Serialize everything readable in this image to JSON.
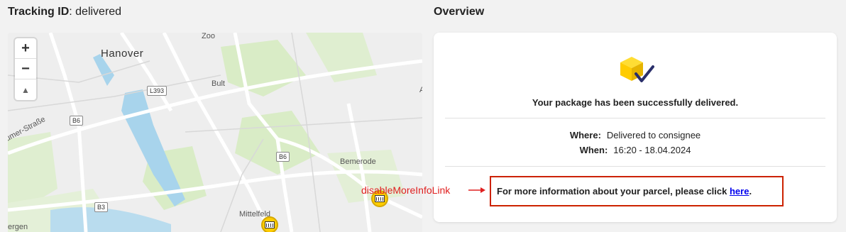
{
  "header": {
    "tracking_label": "Tracking ID",
    "tracking_value": ": delivered",
    "overview_title": "Overview"
  },
  "map": {
    "zoom_in": "+",
    "zoom_out": "−",
    "compass": "▲",
    "labels": {
      "zoo": "Zoo",
      "hanover": "Hanover",
      "bult": "Bult",
      "l393": "L393",
      "b6a": "B6",
      "b6b": "B6",
      "b3": "B3",
      "strasse": "umer-Straße",
      "bemerode": "Bemerode",
      "mittelfeld": "Mittelfeld",
      "bergen": "ergen",
      "a_edge": "A"
    }
  },
  "overview": {
    "status_message": "Your package has been successfully delivered.",
    "where_label": "Where:",
    "where_value": "Delivered to consignee",
    "when_label": "When:",
    "when_value": "16:20 - 18.04.2024",
    "more_info_text": "For more information about your parcel, please click ",
    "more_info_link": "here",
    "more_info_suffix": "."
  },
  "annotation": {
    "label": "disableMoreInfoLink",
    "color": "#e02020"
  },
  "colors": {
    "accent": "#ffcc00",
    "link": "#0000ee",
    "highlight_border": "#cc2200",
    "water": "#a8d4ec",
    "park": "#cfe6b8"
  }
}
